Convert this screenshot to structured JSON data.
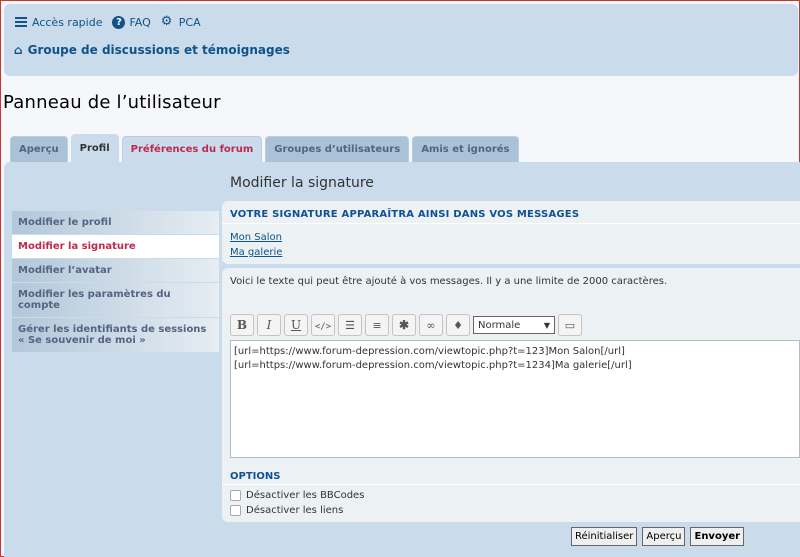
{
  "header": {
    "quicklinks": [
      {
        "label": "Accès rapide",
        "icon": "hamburger-icon"
      },
      {
        "label": "FAQ",
        "icon": "question-icon"
      },
      {
        "label": "PCA",
        "icon": "gear-icon"
      }
    ],
    "breadcrumb": "Groupe de discussions et témoignages"
  },
  "page_title": "Panneau de l’utilisateur",
  "tabs": [
    {
      "label": "Aperçu"
    },
    {
      "label": "Profil"
    },
    {
      "label": "Préférences du forum"
    },
    {
      "label": "Groupes d’utilisateurs"
    },
    {
      "label": "Amis et ignorés"
    }
  ],
  "sidebar": {
    "items": [
      {
        "label": "Modifier le profil"
      },
      {
        "label": "Modifier la signature"
      },
      {
        "label": "Modifier l’avatar"
      },
      {
        "label": "Modifier les paramètres du compte"
      },
      {
        "label": "Gérer les identifiants de sessions « Se souvenir de moi »"
      }
    ]
  },
  "main": {
    "title": "Modifier la signature",
    "preview_heading": "VOTRE SIGNATURE APPARAÎTRA AINSI DANS VOS MESSAGES",
    "preview_links": [
      "Mon Salon",
      "Ma galerie"
    ],
    "hint": "Voici le texte qui peut être ajouté à vos messages. Il y a une limite de 2000 caractères.",
    "toolbar": {
      "bold": "B",
      "italic": "I",
      "underline": "U",
      "font_size_value": "Normale"
    },
    "textarea": "[url=https://www.forum-depression.com/viewtopic.php?t=123]Mon Salon[/url]\n[url=https://www.forum-depression.com/viewtopic.php?t=1234]Ma galerie[/url]",
    "options_title": "OPTIONS",
    "options": [
      "Désactiver les BBCodes",
      "Désactiver les liens"
    ],
    "buttons": {
      "reset": "Réinitialiser",
      "preview": "Aperçu",
      "submit": "Envoyer"
    }
  }
}
